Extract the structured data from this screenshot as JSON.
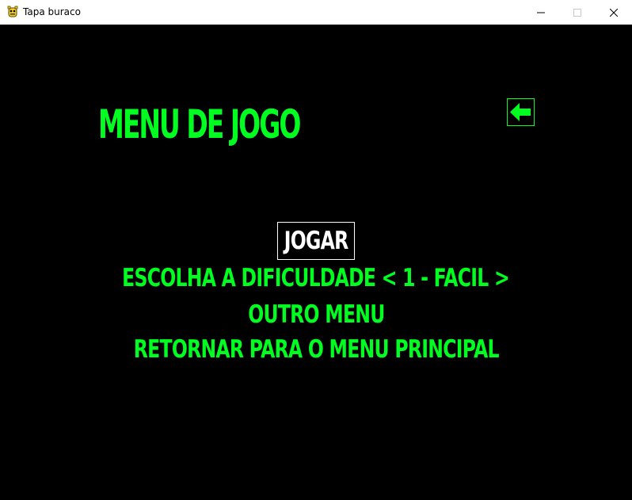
{
  "window": {
    "title": "Tapa buraco",
    "icon": "pygame-snake-icon",
    "controls": {
      "minimize_icon": "minimize-icon",
      "maximize_icon": "maximize-icon",
      "close_icon": "close-icon"
    }
  },
  "game": {
    "heading": "MENU DE JOGO",
    "back_icon": "arrow-left-icon",
    "menu": {
      "selected": "JOGAR",
      "difficulty": "ESCOLHA A DIFICULDADE < 1 - FACIL >",
      "other_menu": "OUTRO MENU",
      "return_main": "RETORNAR PARA O MENU PRINCIPAL"
    }
  },
  "colors": {
    "background": "#000000",
    "accent_green": "#00ff20",
    "selected_white": "#ffffff",
    "titlebar": "#ffffff"
  }
}
